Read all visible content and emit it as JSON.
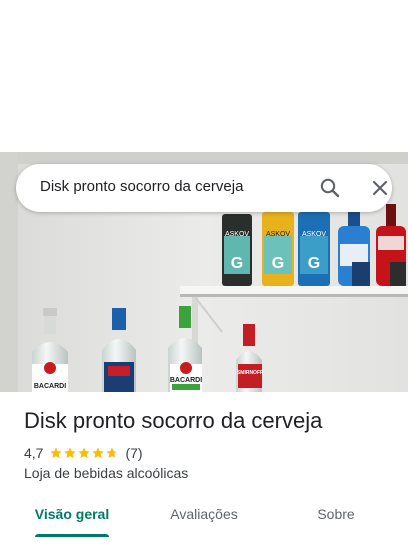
{
  "search": {
    "query": "Disk pronto socorro da cerveja"
  },
  "place": {
    "title": "Disk pronto socorro da cerveja",
    "rating": "4,7",
    "rating_value": 4.7,
    "review_count": "(7)",
    "category": "Loja de bebidas alcoólicas",
    "photo_labels": {
      "bottle_1": "BACARDI",
      "bottle_3": "BACARDI",
      "bottle_4": "SMIRNOFF",
      "can_1": "ASKOV",
      "can_2": "ASKOV",
      "can_3": "ASKOV"
    }
  },
  "tabs": [
    {
      "label": "Visão geral",
      "active": true
    },
    {
      "label": "Avaliações",
      "active": false
    },
    {
      "label": "Sobre",
      "active": false
    }
  ],
  "colors": {
    "accent": "#00796b",
    "star": "#fbbc04"
  }
}
